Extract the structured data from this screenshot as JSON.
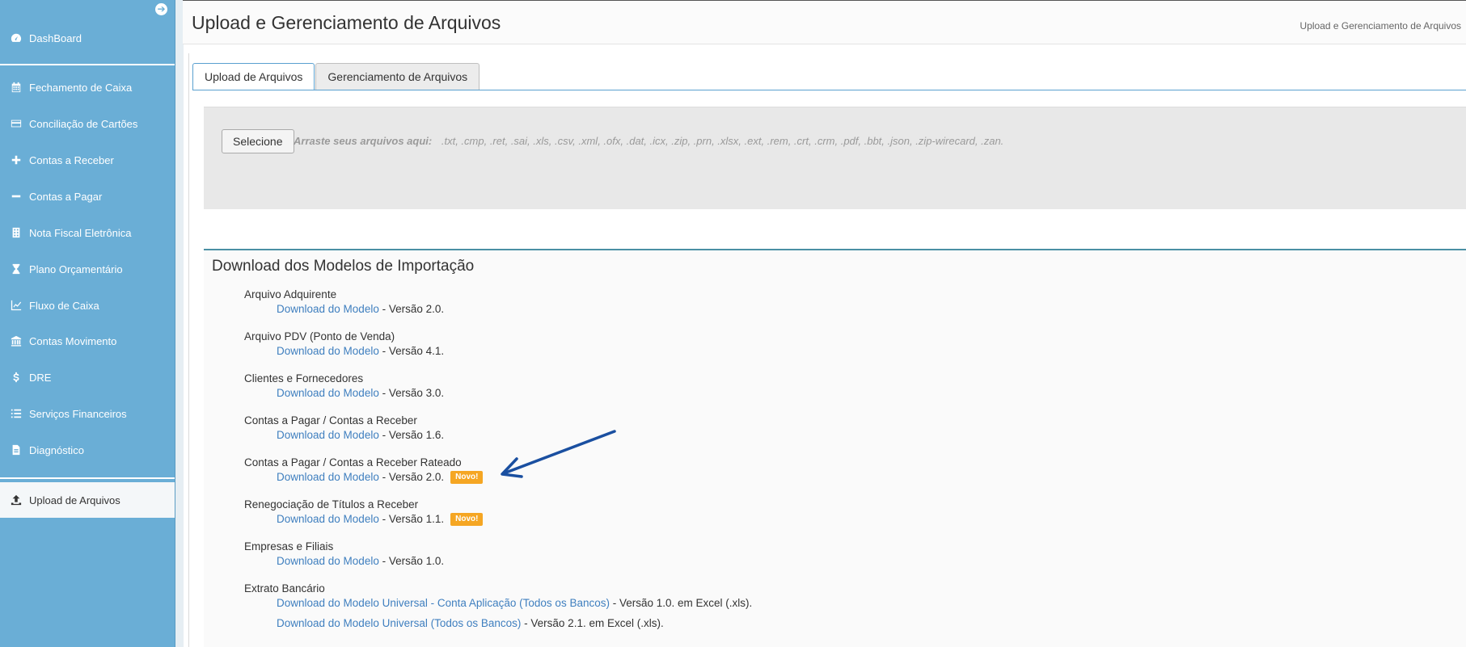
{
  "sidebar": {
    "items": [
      {
        "label": "DashBoard",
        "icon": "dashboard-icon"
      },
      {
        "label": "Fechamento de Caixa",
        "icon": "calendar-icon"
      },
      {
        "label": "Conciliação de Cartões",
        "icon": "credit-card-icon"
      },
      {
        "label": "Contas a Receber",
        "icon": "plus-icon"
      },
      {
        "label": "Contas a Pagar",
        "icon": "minus-icon"
      },
      {
        "label": "Nota Fiscal Eletrônica",
        "icon": "building-icon"
      },
      {
        "label": "Plano Orçamentário",
        "icon": "hourglass-icon"
      },
      {
        "label": "Fluxo de Caixa",
        "icon": "line-chart-icon"
      },
      {
        "label": "Contas Movimento",
        "icon": "bank-icon"
      },
      {
        "label": "DRE",
        "icon": "dollar-icon"
      },
      {
        "label": "Serviços Financeiros",
        "icon": "list-icon"
      },
      {
        "label": "Diagnóstico",
        "icon": "file-icon"
      },
      {
        "label": "Upload de Arquivos",
        "icon": "upload-icon",
        "active": true
      }
    ]
  },
  "header": {
    "title": "Upload e Gerenciamento de Arquivos",
    "breadcrumb": "Upload e Gerenciamento de Arquivos"
  },
  "tabs": [
    {
      "label": "Upload de Arquivos",
      "active": true
    },
    {
      "label": "Gerenciamento de Arquivos",
      "active": false
    }
  ],
  "dropzone": {
    "button_label": "Selecione",
    "hint_label": "Arraste seus arquivos aqui:",
    "extensions": ".txt, .cmp, .ret, .sai, .xls, .csv, .xml, .ofx, .dat, .icx, .zip, .prn, .xlsx, .ext, .rem, .crt, .crm, .pdf, .bbt, .json, .zip-wirecard, .zan."
  },
  "models_panel": {
    "title": "Download dos Modelos de Importação",
    "models": [
      {
        "name": "Arquivo Adquirente",
        "link": "Download do Modelo",
        "suffix": " - Versão 2.0.",
        "badge": ""
      },
      {
        "name": "Arquivo PDV (Ponto de Venda)",
        "link": "Download do Modelo",
        "suffix": " - Versão 4.1.",
        "badge": ""
      },
      {
        "name": "Clientes e Fornecedores",
        "link": "Download do Modelo",
        "suffix": " - Versão 3.0.",
        "badge": ""
      },
      {
        "name": "Contas a Pagar / Contas a Receber",
        "link": "Download do Modelo",
        "suffix": " - Versão 1.6.",
        "badge": ""
      },
      {
        "name": "Contas a Pagar / Contas a Receber Rateado",
        "link": "Download do Modelo",
        "suffix": " - Versão 2.0.",
        "badge": "Novo!"
      },
      {
        "name": "Renegociação de Títulos a Receber",
        "link": "Download do Modelo",
        "suffix": " - Versão 1.1.",
        "badge": "Novo!"
      },
      {
        "name": "Empresas e Filiais",
        "link": "Download do Modelo",
        "suffix": " - Versão 1.0.",
        "badge": ""
      }
    ],
    "extrato": {
      "name": "Extrato Bancário",
      "links": [
        {
          "link": "Download do Modelo Universal - Conta Aplicação (Todos os Bancos)",
          "suffix": " - Versão 1.0. em Excel (.xls)."
        },
        {
          "link": "Download do Modelo Universal (Todos os Bancos)",
          "suffix": " - Versão 2.1. em Excel (.xls)."
        }
      ]
    }
  },
  "colors": {
    "sidebar": "#6aaed6",
    "link": "#3f7fbf",
    "badge": "#f5a623",
    "arrow": "#1a4fa0"
  }
}
